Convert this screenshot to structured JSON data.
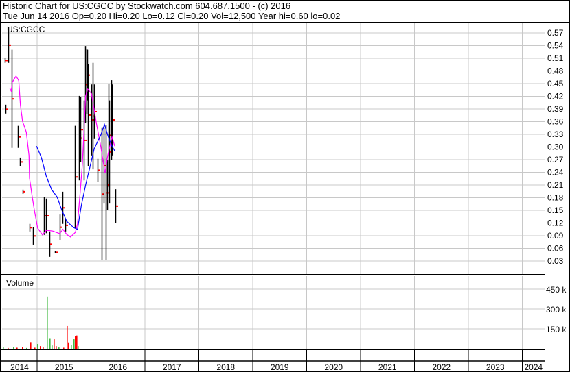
{
  "header": {
    "title": "Historic Chart for US:CGCC by Stockwatch.com 604.687.1500 - (c) 2016",
    "quote": "Tue Jun 14 2016  Op=0.20  Hi=0.20  Lo=0.12  Cl=0.20  Vol=12,500  Year hi=0.60  lo=0.02"
  },
  "colors": {
    "bar": "#000000",
    "tick": "#ff0000",
    "ma_short": "#ff00ff",
    "ma_long": "#0000ff",
    "vol_up": "#44bb44",
    "vol_down": "#ff0000",
    "grid": "#c8c8c8"
  },
  "chart_data": [
    {
      "type": "line",
      "title": "US:CGCC",
      "ylim": [
        0.0,
        0.6
      ],
      "yticks": [
        "0.03",
        "0.06",
        "0.09",
        "0.12",
        "0.15",
        "0.18",
        "0.21",
        "0.24",
        "0.27",
        "0.30",
        "0.33",
        "0.36",
        "0.39",
        "0.42",
        "0.45",
        "0.48",
        "0.51",
        "0.54",
        "0.57"
      ],
      "xlim": [
        2014.33,
        2024.31
      ],
      "xticks": [
        "2014",
        "2015",
        "2016",
        "2017",
        "2018",
        "2019",
        "2020",
        "2021",
        "2022",
        "2023",
        "2024"
      ],
      "grid": true,
      "bars": [
        {
          "x": 2014.4,
          "hi": 0.51,
          "lo": 0.499
        },
        {
          "x": 2014.41,
          "hi": 0.4,
          "lo": 0.379
        },
        {
          "x": 2014.46,
          "hi": 0.583,
          "lo": 0.499
        },
        {
          "x": 2014.53,
          "hi": 0.53,
          "lo": 0.298
        },
        {
          "x": 2014.64,
          "hi": 0.35,
          "lo": 0.298
        },
        {
          "x": 2014.68,
          "hi": 0.275,
          "lo": 0.254
        },
        {
          "x": 2014.73,
          "hi": 0.199,
          "lo": 0.189
        },
        {
          "x": 2014.86,
          "hi": 0.118,
          "lo": 0.1
        },
        {
          "x": 2014.92,
          "hi": 0.11,
          "lo": 0.069
        },
        {
          "x": 2015.13,
          "hi": 0.182,
          "lo": 0.092
        },
        {
          "x": 2015.17,
          "hi": 0.178,
          "lo": 0.096
        },
        {
          "x": 2015.23,
          "hi": 0.1,
          "lo": 0.04
        },
        {
          "x": 2015.33,
          "hi": 0.053,
          "lo": 0.048
        },
        {
          "x": 2015.42,
          "hi": 0.14,
          "lo": 0.08
        },
        {
          "x": 2015.47,
          "hi": 0.194,
          "lo": 0.118
        },
        {
          "x": 2015.52,
          "hi": 0.129,
          "lo": 0.1
        },
        {
          "x": 2015.7,
          "hi": 0.35,
          "lo": 0.108
        },
        {
          "x": 2015.78,
          "hi": 0.421,
          "lo": 0.221
        },
        {
          "x": 2015.8,
          "hi": 0.418,
          "lo": 0.264
        },
        {
          "x": 2015.87,
          "hi": 0.41,
          "lo": 0.221
        },
        {
          "x": 2015.89,
          "hi": 0.539,
          "lo": 0.356
        },
        {
          "x": 2015.92,
          "hi": 0.531,
          "lo": 0.377
        },
        {
          "x": 2015.93,
          "hi": 0.53,
          "lo": 0.41
        },
        {
          "x": 2015.94,
          "hi": 0.497,
          "lo": 0.254
        },
        {
          "x": 2016.01,
          "hi": 0.448,
          "lo": 0.28
        },
        {
          "x": 2016.03,
          "hi": 0.499,
          "lo": 0.247
        },
        {
          "x": 2016.06,
          "hi": 0.448,
          "lo": 0.319
        },
        {
          "x": 2016.12,
          "hi": 0.272,
          "lo": 0.218
        },
        {
          "x": 2016.2,
          "hi": 0.345,
          "lo": 0.032
        },
        {
          "x": 2016.24,
          "hi": 0.345,
          "lo": 0.166
        },
        {
          "x": 2016.27,
          "hi": 0.351,
          "lo": 0.032
        },
        {
          "x": 2016.3,
          "hi": 0.27,
          "lo": 0.15
        },
        {
          "x": 2016.32,
          "hi": 0.45,
          "lo": 0.205
        },
        {
          "x": 2016.34,
          "hi": 0.41,
          "lo": 0.166
        },
        {
          "x": 2016.38,
          "hi": 0.458,
          "lo": 0.27
        },
        {
          "x": 2016.39,
          "hi": 0.448,
          "lo": 0.28
        },
        {
          "x": 2016.45,
          "hi": 0.2,
          "lo": 0.12
        }
      ],
      "series": [
        {
          "name": "ma_short",
          "x": [
            2014.49,
            2014.52,
            2014.54,
            2014.61,
            2014.66,
            2014.69,
            2014.73,
            2014.8,
            2014.85,
            2014.86,
            2014.91,
            2014.95,
            2015.01,
            2015.1,
            2015.17,
            2015.29,
            2015.42,
            2015.48,
            2015.55,
            2015.62,
            2015.71,
            2015.75,
            2015.8,
            2015.84,
            2015.9,
            2015.94,
            2016.01,
            2016.1,
            2016.18,
            2016.26,
            2016.31,
            2016.39,
            2016.44
          ],
          "y": [
            0.44,
            0.432,
            0.453,
            0.468,
            0.457,
            0.4,
            0.361,
            0.335,
            0.28,
            0.226,
            0.182,
            0.15,
            0.108,
            0.092,
            0.103,
            0.101,
            0.095,
            0.105,
            0.093,
            0.087,
            0.098,
            0.118,
            0.194,
            0.259,
            0.421,
            0.437,
            0.426,
            0.356,
            0.302,
            0.238,
            0.28,
            0.324,
            0.302
          ]
        },
        {
          "name": "ma_long",
          "x": [
            2014.99,
            2015.08,
            2015.17,
            2015.27,
            2015.37,
            2015.46,
            2015.55,
            2015.68,
            2015.75,
            2015.82,
            2015.9,
            2015.97,
            2016.06,
            2016.18,
            2016.25,
            2016.32,
            2016.39,
            2016.44
          ],
          "y": [
            0.302,
            0.275,
            0.231,
            0.199,
            0.182,
            0.15,
            0.124,
            0.109,
            0.105,
            0.161,
            0.21,
            0.247,
            0.296,
            0.328,
            0.353,
            0.324,
            0.302,
            0.291
          ]
        }
      ]
    },
    {
      "type": "bar",
      "title": "Volume",
      "ylim": [
        0,
        520000
      ],
      "yticks": [
        {
          "v": 150000,
          "label": "150 k"
        },
        {
          "v": 300000,
          "label": "300 k"
        },
        {
          "v": 450000,
          "label": "450 k"
        }
      ],
      "values": [
        {
          "x": 2014.36,
          "v": 12000,
          "up": true
        },
        {
          "x": 2014.45,
          "v": 6000,
          "up": false
        },
        {
          "x": 2014.55,
          "v": 15000,
          "up": true
        },
        {
          "x": 2014.62,
          "v": 8000,
          "up": false
        },
        {
          "x": 2014.72,
          "v": 12000,
          "up": false
        },
        {
          "x": 2014.8,
          "v": 6000,
          "up": true
        },
        {
          "x": 2014.87,
          "v": 50000,
          "up": false
        },
        {
          "x": 2014.95,
          "v": 8000,
          "up": false
        },
        {
          "x": 2015.0,
          "v": 36000,
          "up": true
        },
        {
          "x": 2015.05,
          "v": 20000,
          "up": false
        },
        {
          "x": 2015.1,
          "v": 15000,
          "up": false
        },
        {
          "x": 2015.18,
          "v": 394000,
          "up": true
        },
        {
          "x": 2015.23,
          "v": 75000,
          "up": true
        },
        {
          "x": 2015.27,
          "v": 25000,
          "up": true
        },
        {
          "x": 2015.31,
          "v": 72000,
          "up": false
        },
        {
          "x": 2015.35,
          "v": 20000,
          "up": false
        },
        {
          "x": 2015.4,
          "v": 10000,
          "up": true
        },
        {
          "x": 2015.48,
          "v": 8000,
          "up": false
        },
        {
          "x": 2015.55,
          "v": 171000,
          "up": false
        },
        {
          "x": 2015.57,
          "v": 48000,
          "up": false
        },
        {
          "x": 2015.63,
          "v": 30000,
          "up": true
        },
        {
          "x": 2015.68,
          "v": 72000,
          "up": true
        },
        {
          "x": 2015.7,
          "v": 95000,
          "up": false
        },
        {
          "x": 2015.72,
          "v": 100000,
          "up": false
        },
        {
          "x": 2015.75,
          "v": 20000,
          "up": true
        }
      ]
    }
  ]
}
